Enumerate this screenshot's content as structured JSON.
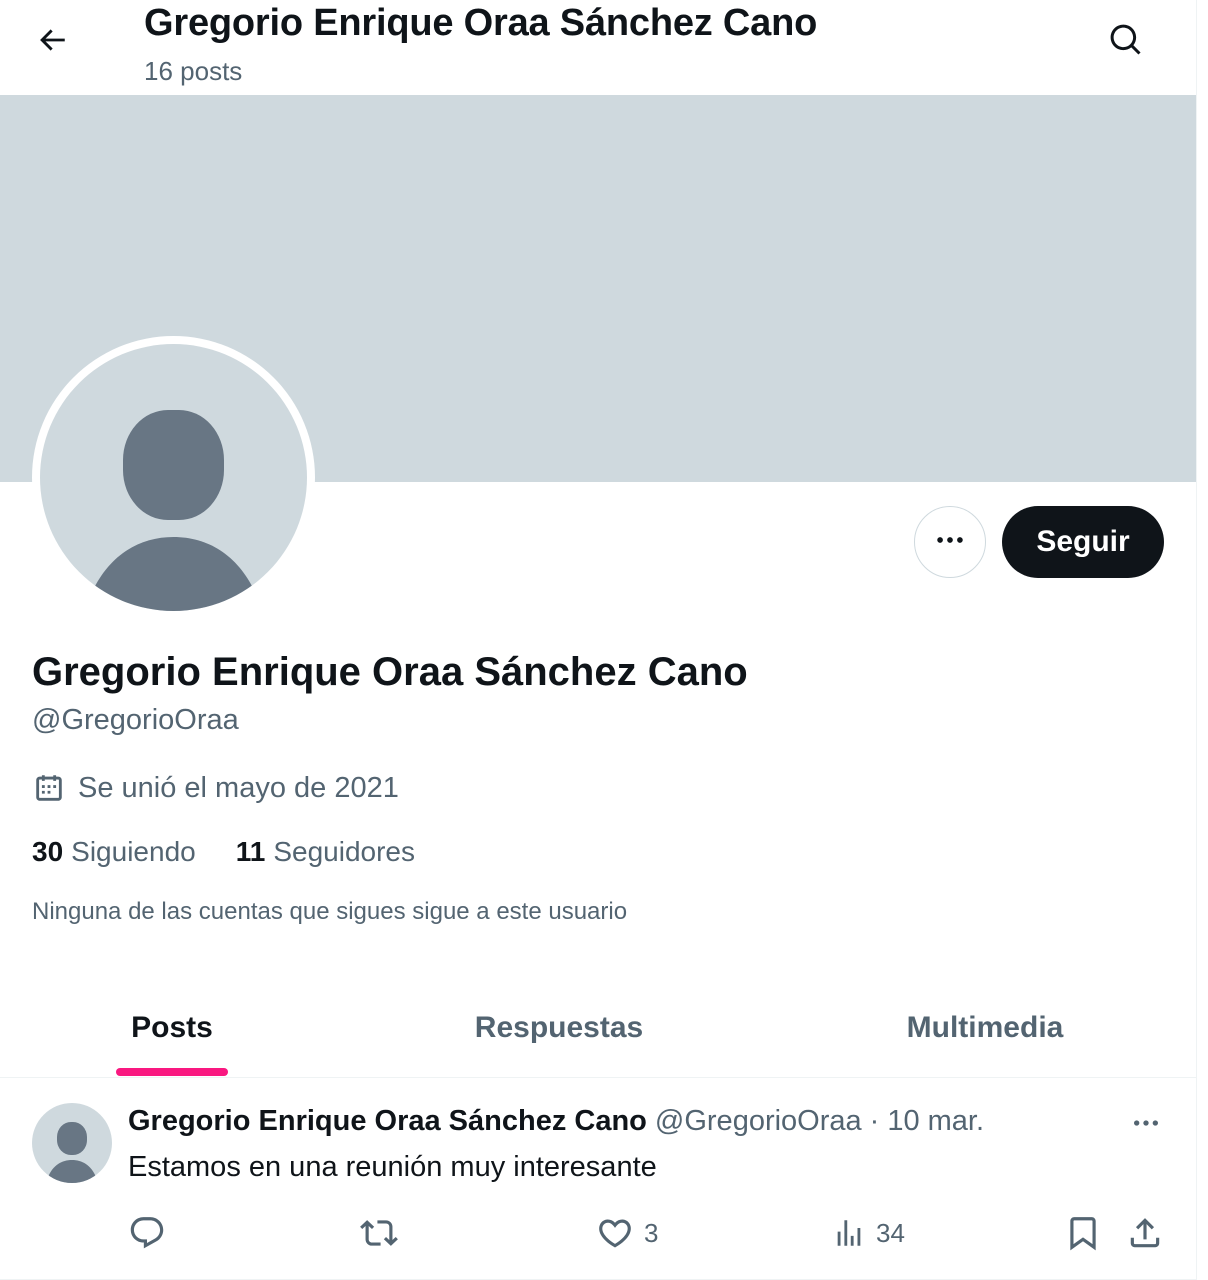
{
  "header": {
    "title": "Gregorio Enrique Oraa Sánchez Cano",
    "post_count": "16 posts",
    "back_icon": "arrow-left-icon",
    "search_icon": "search-icon"
  },
  "profile": {
    "display_name": "Gregorio Enrique Oraa Sánchez Cano",
    "handle": "@GregorioOraa",
    "joined": "Se unió el mayo de 2021",
    "following_count": "30",
    "following_label": "Siguiendo",
    "followers_count": "11",
    "followers_label": "Seguidores",
    "followed_by_note": "Ninguna de las cuentas que sigues sigue a este usuario",
    "follow_button": "Seguir",
    "banner_color": "#cfd9de"
  },
  "tabs": [
    {
      "label": "Posts",
      "active": true
    },
    {
      "label": "Respuestas",
      "active": false
    },
    {
      "label": "Multimedia",
      "active": false
    }
  ],
  "post": {
    "author_name": "Gregorio Enrique Oraa Sánchez Cano",
    "author_handle": "@GregorioOraa",
    "separator": "·",
    "date": "10 mar.",
    "text": "Estamos en una reunión muy interesante",
    "replies": "",
    "reposts": "",
    "likes": "3",
    "views": "34"
  },
  "colors": {
    "accent_tab_underline": "#f91880",
    "text_primary": "#0f1419",
    "text_secondary": "#536471",
    "follow_button_bg": "#0f1419"
  }
}
